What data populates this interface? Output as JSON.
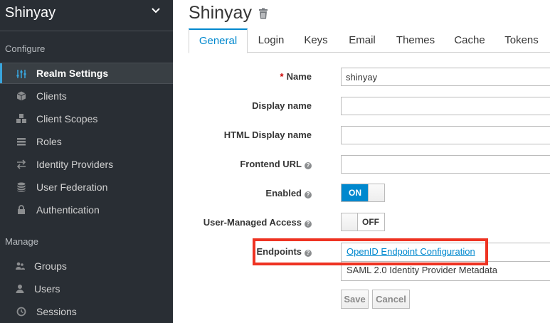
{
  "sidebar": {
    "realm": "Shinyay",
    "sections": {
      "configure": "Configure",
      "manage": "Manage"
    },
    "configure_items": [
      {
        "label": "Realm Settings",
        "icon": "sliders-icon",
        "active": true
      },
      {
        "label": "Clients",
        "icon": "cube-icon"
      },
      {
        "label": "Client Scopes",
        "icon": "cubes-icon"
      },
      {
        "label": "Roles",
        "icon": "list-icon"
      },
      {
        "label": "Identity Providers",
        "icon": "exchange-icon"
      },
      {
        "label": "User Federation",
        "icon": "database-icon"
      },
      {
        "label": "Authentication",
        "icon": "lock-icon"
      }
    ],
    "manage_items": [
      {
        "label": "Groups",
        "icon": "users-icon"
      },
      {
        "label": "Users",
        "icon": "user-icon"
      },
      {
        "label": "Sessions",
        "icon": "clock-icon"
      }
    ]
  },
  "main": {
    "title": "Shinyay",
    "tabs": [
      "General",
      "Login",
      "Keys",
      "Email",
      "Themes",
      "Cache",
      "Tokens"
    ],
    "active_tab": "General",
    "form": {
      "required_mark": "*",
      "name_label": "Name",
      "name_value": "shinyay",
      "display_name_label": "Display name",
      "display_name_value": "",
      "html_display_name_label": "HTML Display name",
      "html_display_name_value": "",
      "frontend_url_label": "Frontend URL",
      "frontend_url_value": "",
      "enabled_label": "Enabled",
      "enabled_state": "ON",
      "user_managed_access_label": "User-Managed Access",
      "user_managed_access_state": "OFF",
      "endpoints_label": "Endpoints",
      "endpoint_openid": "OpenID Endpoint Configuration",
      "endpoint_saml": "SAML 2.0 Identity Provider Metadata",
      "help_glyph": "?"
    },
    "buttons": {
      "save": "Save",
      "cancel": "Cancel"
    }
  },
  "colors": {
    "sidebar_bg": "#292e34",
    "accent": "#0088ce",
    "highlight": "#ee3322"
  }
}
